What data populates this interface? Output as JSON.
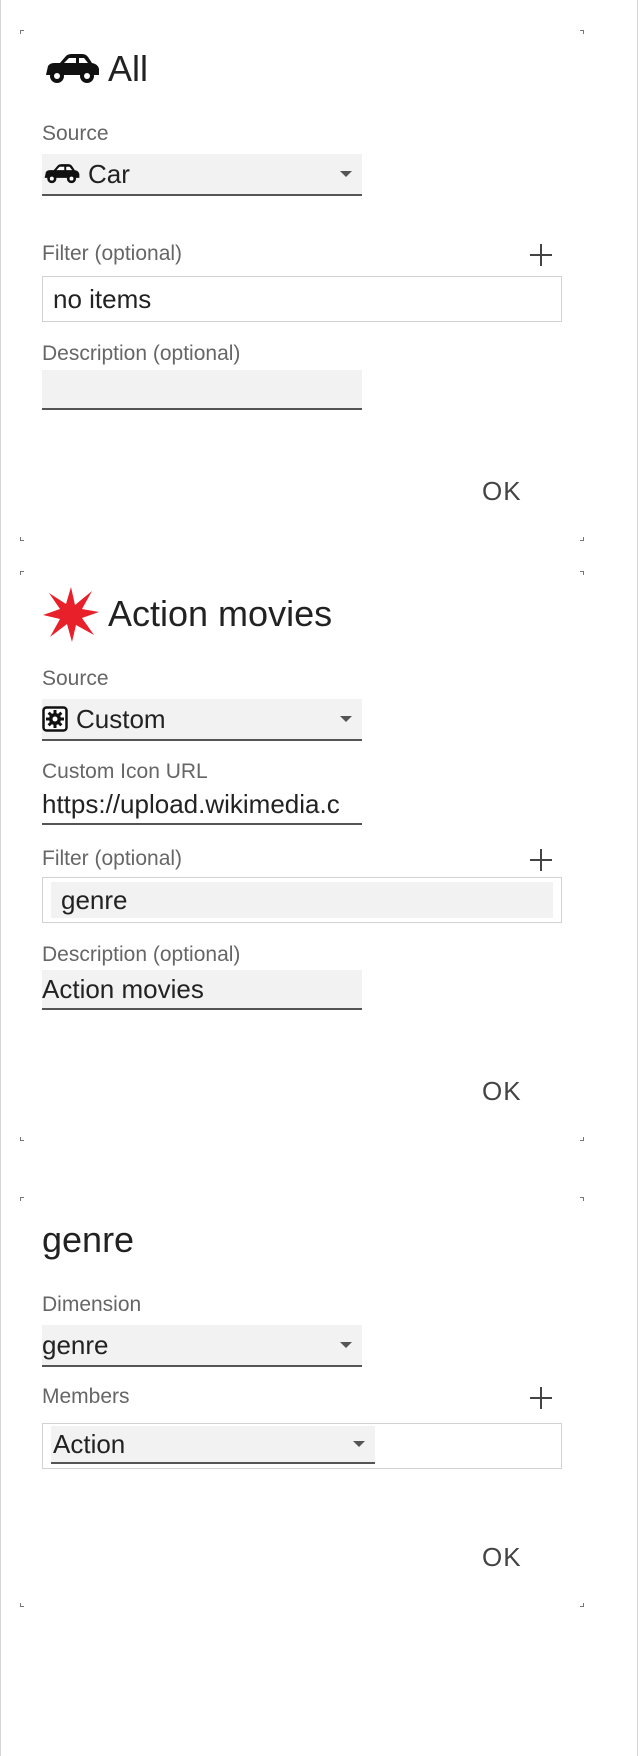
{
  "panels": [
    {
      "title": "All",
      "title_icon": "car-icon",
      "source_label": "Source",
      "source_value": "Car",
      "source_icon": "car-icon",
      "filter_label": "Filter (optional)",
      "filter_value": "no items",
      "description_label": "Description (optional)",
      "description_value": "",
      "ok_label": "OK"
    },
    {
      "title": "Action movies",
      "title_icon": "red-star-burst-icon",
      "source_label": "Source",
      "source_value": "Custom",
      "source_icon": "gear-box-icon",
      "custom_icon_label": "Custom Icon URL",
      "custom_icon_value": "https://upload.wikimedia.c",
      "filter_label": "Filter (optional)",
      "filter_value": "genre",
      "description_label": "Description (optional)",
      "description_value": "Action movies",
      "ok_label": "OK"
    },
    {
      "title": "genre",
      "dimension_label": "Dimension",
      "dimension_value": "genre",
      "members_label": "Members",
      "members_value": "Action",
      "ok_label": "OK"
    }
  ],
  "colors": {
    "accent_red": "#e8202a",
    "underline": "#555555",
    "field_bg": "#f2f2f2"
  }
}
